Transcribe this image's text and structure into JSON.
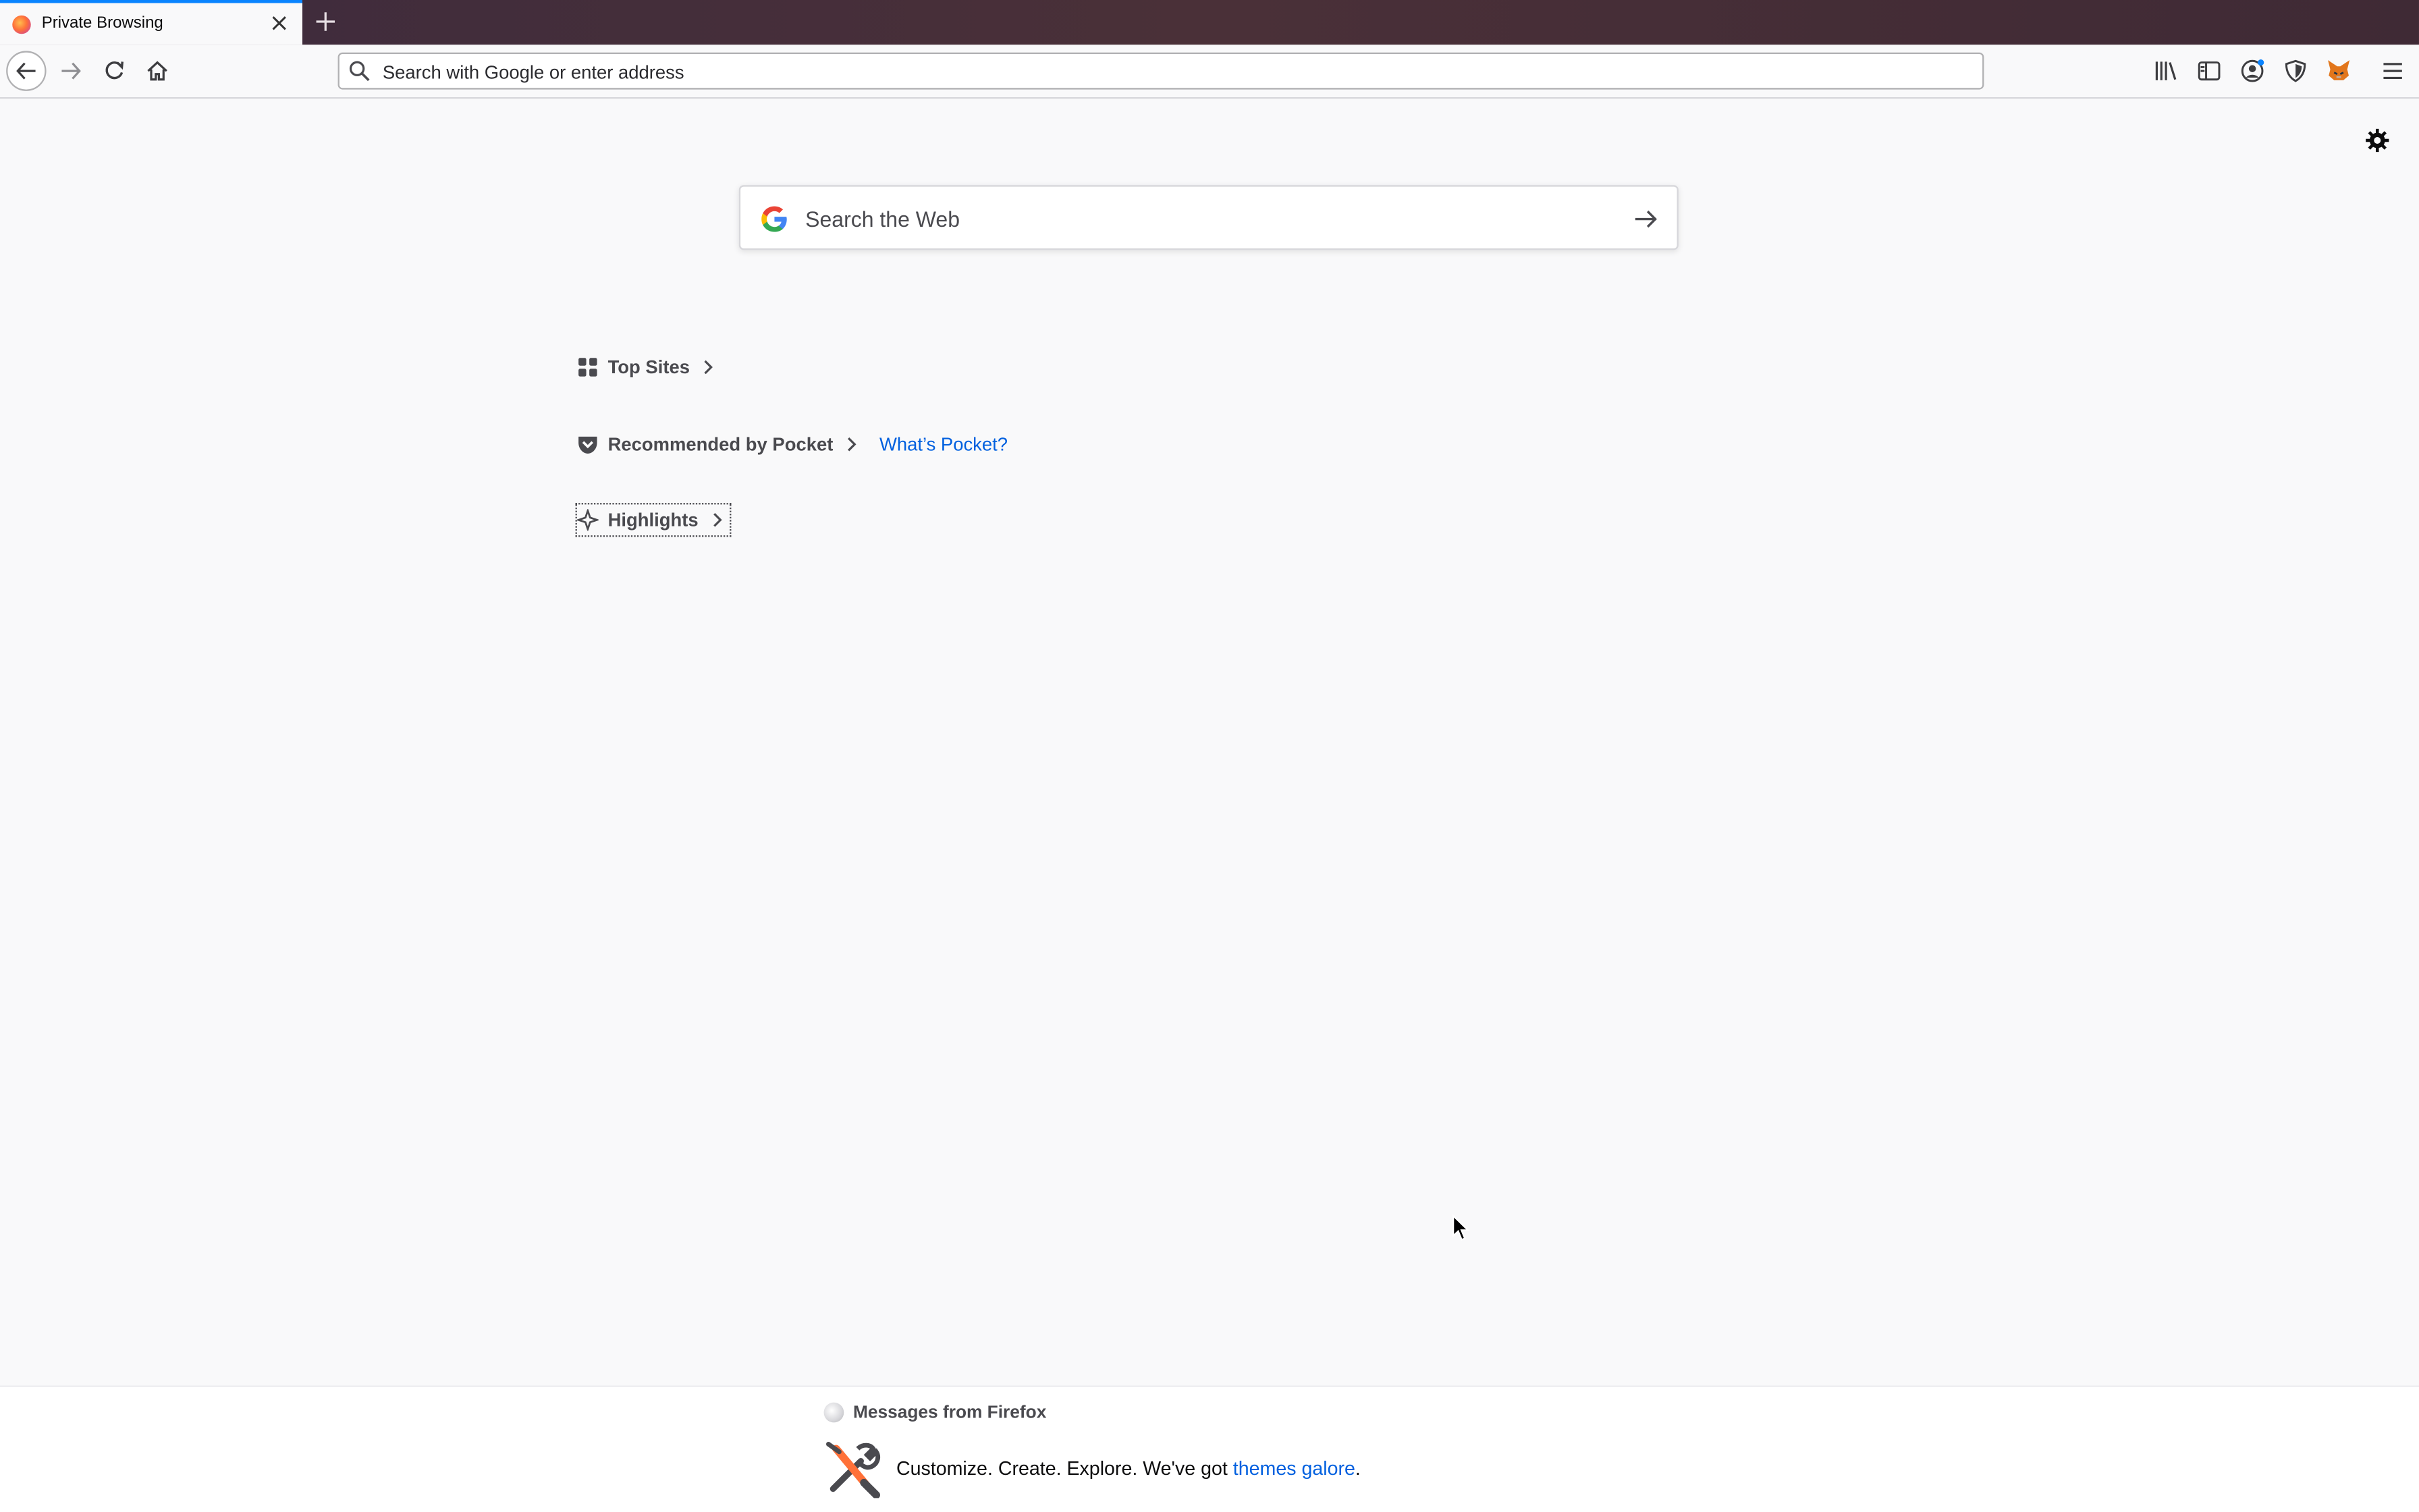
{
  "tab": {
    "title": "Private Browsing",
    "close_icon": "close-icon",
    "new_tab_icon": "plus-icon"
  },
  "toolbar": {
    "back_icon": "arrow-left-icon",
    "forward_icon": "arrow-right-icon",
    "reload_icon": "reload-icon",
    "home_icon": "home-icon",
    "url_placeholder": "Search with Google or enter address",
    "right_icons": [
      "library-icon",
      "sidebar-icon",
      "account-icon",
      "shield-icon",
      "metamask-fox-icon",
      "hamburger-menu-icon"
    ]
  },
  "newtab": {
    "settings_icon": "gear-icon",
    "search_placeholder": "Search the Web",
    "sections": {
      "top_sites": "Top Sites",
      "pocket": "Recommended by Pocket",
      "pocket_link": "What’s Pocket?",
      "highlights": "Highlights"
    }
  },
  "messages": {
    "header": "Messages from Firefox",
    "text_before": "Customize. Create. Explore. We've got ",
    "link_text": "themes galore",
    "text_after": "."
  },
  "colors": {
    "accent": "#0a84ff",
    "link": "#0060df",
    "background": "#f9f9fa"
  }
}
